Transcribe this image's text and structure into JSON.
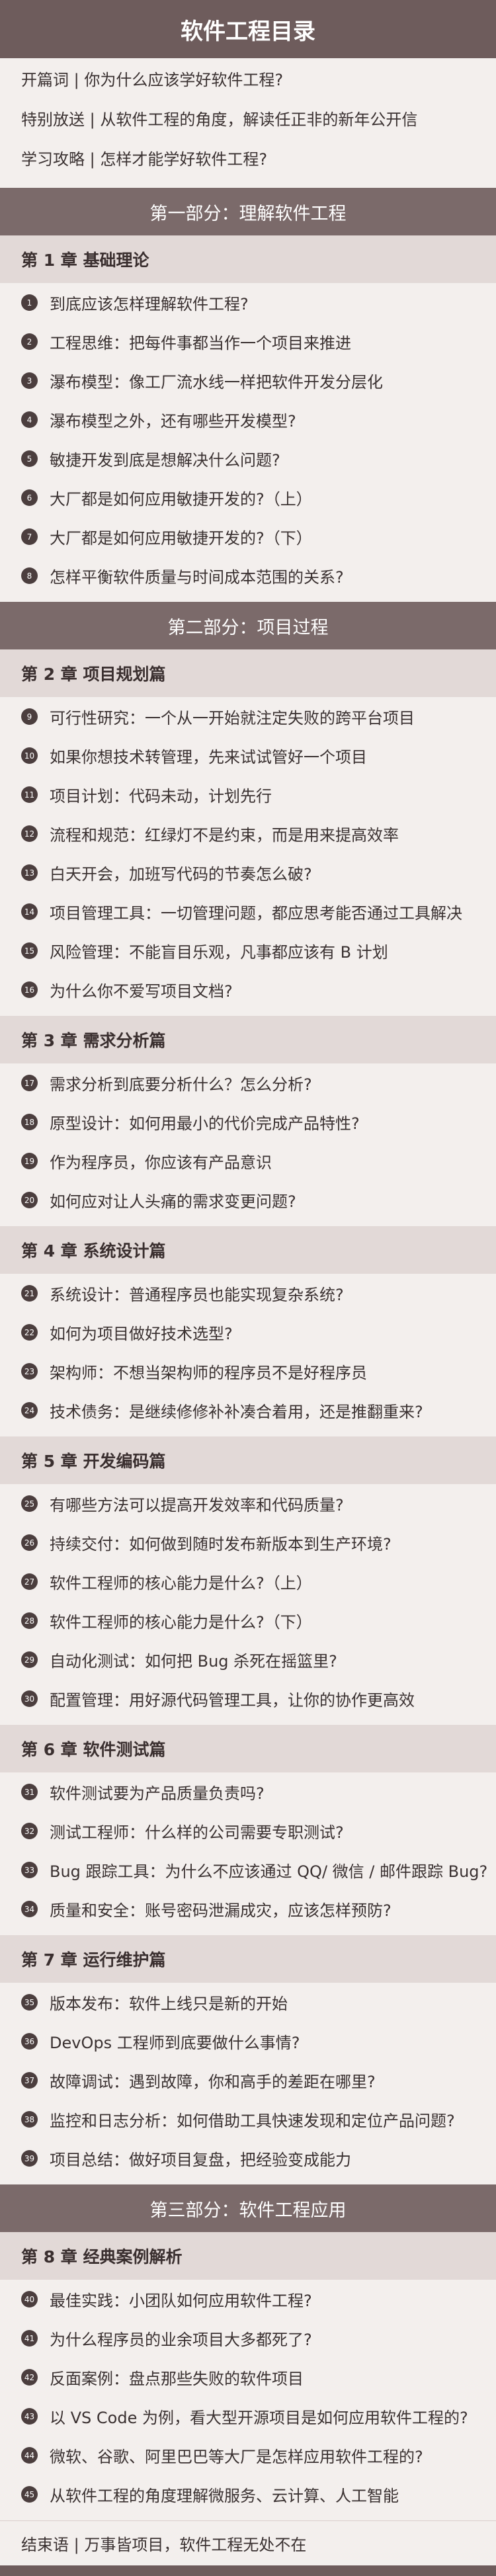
{
  "title": "软件工程目录",
  "intro": [
    "开篇词 | 你为什么应该学好软件工程?",
    "特别放送 | 从软件工程的角度，解读任正非的新年公开信",
    "学习攻略 | 怎样才能学好软件工程?"
  ],
  "parts": [
    {
      "title": "第一部分：理解软件工程",
      "chapters": [
        {
          "title": "第 1 章  基础理论",
          "items": [
            {
              "n": "1",
              "text": "到底应该怎样理解软件工程?"
            },
            {
              "n": "2",
              "text": "工程思维：把每件事都当作一个项目来推进"
            },
            {
              "n": "3",
              "text": "瀑布模型：像工厂流水线一样把软件开发分层化"
            },
            {
              "n": "4",
              "text": "瀑布模型之外，还有哪些开发模型?"
            },
            {
              "n": "5",
              "text": "敏捷开发到底是想解决什么问题?"
            },
            {
              "n": "6",
              "text": "大厂都是如何应用敏捷开发的?（上）"
            },
            {
              "n": "7",
              "text": "大厂都是如何应用敏捷开发的?（下）"
            },
            {
              "n": "8",
              "text": "怎样平衡软件质量与时间成本范围的关系?"
            }
          ]
        }
      ]
    },
    {
      "title": "第二部分：项目过程",
      "chapters": [
        {
          "title": "第 2 章  项目规划篇",
          "items": [
            {
              "n": "9",
              "text": "可行性研究：一个从一开始就注定失败的跨平台项目"
            },
            {
              "n": "10",
              "text": "如果你想技术转管理，先来试试管好一个项目"
            },
            {
              "n": "11",
              "text": "项目计划：代码未动，计划先行"
            },
            {
              "n": "12",
              "text": "流程和规范：红绿灯不是约束，而是用来提高效率"
            },
            {
              "n": "13",
              "text": "白天开会，加班写代码的节奏怎么破?"
            },
            {
              "n": "14",
              "text": "项目管理工具：一切管理问题，都应思考能否通过工具解决"
            },
            {
              "n": "15",
              "text": "风险管理：不能盲目乐观，凡事都应该有 B 计划"
            },
            {
              "n": "16",
              "text": "为什么你不爱写项目文档?"
            }
          ]
        },
        {
          "title": "第 3 章  需求分析篇",
          "items": [
            {
              "n": "17",
              "text": "需求分析到底要分析什么？怎么分析?"
            },
            {
              "n": "18",
              "text": "原型设计：如何用最小的代价完成产品特性?"
            },
            {
              "n": "19",
              "text": "作为程序员，你应该有产品意识"
            },
            {
              "n": "20",
              "text": "如何应对让人头痛的需求变更问题?"
            }
          ]
        },
        {
          "title": "第 4 章  系统设计篇",
          "items": [
            {
              "n": "21",
              "text": "系统设计：普通程序员也能实现复杂系统?"
            },
            {
              "n": "22",
              "text": "如何为项目做好技术选型?"
            },
            {
              "n": "23",
              "text": "架构师：不想当架构师的程序员不是好程序员"
            },
            {
              "n": "24",
              "text": "技术债务：是继续修修补补凑合着用，还是推翻重来?"
            }
          ]
        },
        {
          "title": "第 5 章  开发编码篇",
          "items": [
            {
              "n": "25",
              "text": "有哪些方法可以提高开发效率和代码质量?"
            },
            {
              "n": "26",
              "text": "持续交付：如何做到随时发布新版本到生产环境?"
            },
            {
              "n": "27",
              "text": "软件工程师的核心能力是什么?（上）"
            },
            {
              "n": "28",
              "text": "软件工程师的核心能力是什么?（下）"
            },
            {
              "n": "29",
              "text": "自动化测试：如何把 Bug 杀死在摇篮里?"
            },
            {
              "n": "30",
              "text": "配置管理：用好源代码管理工具，让你的协作更高效"
            }
          ]
        },
        {
          "title": "第 6 章  软件测试篇",
          "items": [
            {
              "n": "31",
              "text": "软件测试要为产品质量负责吗?"
            },
            {
              "n": "32",
              "text": "测试工程师：什么样的公司需要专职测试?"
            },
            {
              "n": "33",
              "text": "Bug 跟踪工具：为什么不应该通过 QQ/ 微信 / 邮件跟踪 Bug?"
            },
            {
              "n": "34",
              "text": "质量和安全：账号密码泄漏成灾，应该怎样预防?"
            }
          ]
        },
        {
          "title": "第 7 章  运行维护篇",
          "items": [
            {
              "n": "35",
              "text": "版本发布：软件上线只是新的开始"
            },
            {
              "n": "36",
              "text": "DevOps 工程师到底要做什么事情?"
            },
            {
              "n": "37",
              "text": "故障调试：遇到故障，你和高手的差距在哪里?"
            },
            {
              "n": "38",
              "text": "监控和日志分析：如何借助工具快速发现和定位产品问题?"
            },
            {
              "n": "39",
              "text": "项目总结：做好项目复盘，把经验变成能力"
            }
          ]
        }
      ]
    },
    {
      "title": "第三部分：软件工程应用",
      "chapters": [
        {
          "title": "第 8 章  经典案例解析",
          "items": [
            {
              "n": "40",
              "text": "最佳实践：小团队如何应用软件工程?"
            },
            {
              "n": "41",
              "text": "为什么程序员的业余项目大多都死了?"
            },
            {
              "n": "42",
              "text": "反面案例：盘点那些失败的软件项目"
            },
            {
              "n": "43",
              "text": "以 VS Code 为例，看大型开源项目是如何应用软件工程的?"
            },
            {
              "n": "44",
              "text": "微软、谷歌、阿里巴巴等大厂是怎样应用软件工程的?"
            },
            {
              "n": "45",
              "text": "从软件工程的角度理解微服务、云计算、人工智能"
            }
          ]
        }
      ]
    }
  ],
  "closing": "结束语 | 万事皆项目，软件工程无处不在"
}
